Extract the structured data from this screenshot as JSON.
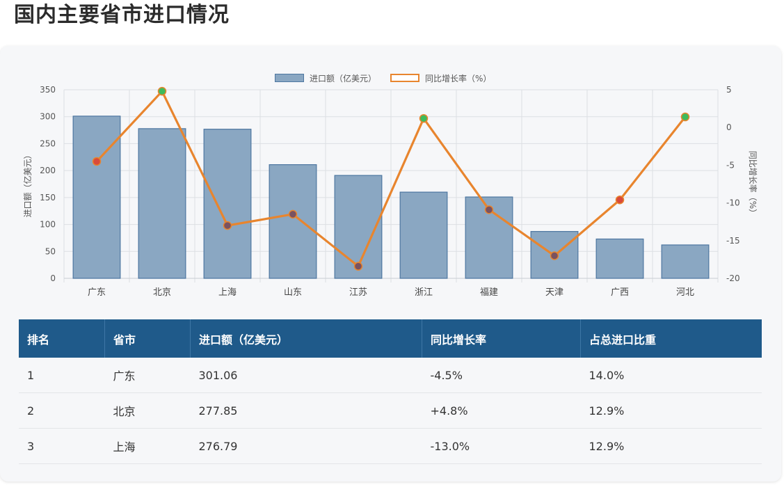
{
  "page": {
    "title": "国内主要省市进口情况"
  },
  "legend": {
    "bar_label": "进口额（亿美元）",
    "line_label": "同比增长率（%）"
  },
  "colors": {
    "bar_fill": "#8aa7c2",
    "bar_stroke": "#4d76a0",
    "line": "#e8852e",
    "point_positive": "#3dbb5d",
    "point_negative": "#d94a3a",
    "table_header": "#1f5a8a",
    "negative_text": "#e0463a",
    "positive_text": "#2bb54a"
  },
  "chart_data": {
    "type": "bar",
    "categories": [
      "广东",
      "北京",
      "上海",
      "山东",
      "江苏",
      "浙江",
      "福建",
      "天津",
      "广西",
      "河北"
    ],
    "series": [
      {
        "name": "进口额（亿美元）",
        "type": "bar",
        "axis": "left",
        "values": [
          301.06,
          277.85,
          276.79,
          211,
          191,
          160,
          151,
          87,
          73,
          62
        ]
      },
      {
        "name": "同比增长率（%）",
        "type": "line",
        "axis": "right",
        "values": [
          -4.5,
          4.8,
          -13.0,
          -11.5,
          -18.4,
          1.2,
          -10.9,
          -17.0,
          -9.6,
          1.4
        ]
      }
    ],
    "ylabel": "进口额（亿美元）",
    "y2label": "同比增长率（%）",
    "ylim": [
      0,
      350
    ],
    "y2lim": [
      -20,
      5
    ],
    "yticks": [
      0,
      50,
      100,
      150,
      200,
      250,
      300,
      350
    ],
    "y2ticks": [
      -20,
      -15,
      -10,
      -5,
      0,
      5
    ],
    "grid": true,
    "legend_position": "top-center"
  },
  "table": {
    "headers": [
      "排名",
      "省市",
      "进口额（亿美元）",
      "同比增长率",
      "占总进口比重"
    ],
    "rows": [
      [
        "1",
        "广东",
        "301.06",
        "-4.5%",
        "14.0%"
      ],
      [
        "2",
        "北京",
        "277.85",
        "+4.8%",
        "12.9%"
      ],
      [
        "3",
        "上海",
        "276.79",
        "-13.0%",
        "12.9%"
      ]
    ]
  }
}
